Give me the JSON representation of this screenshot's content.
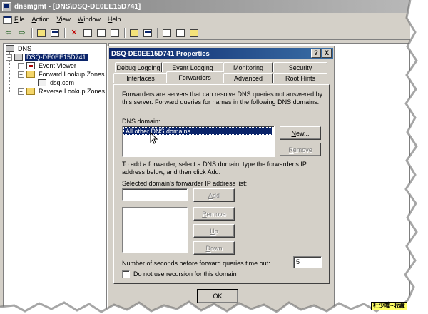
{
  "window": {
    "title": "dnsmgmt - [DNS\\DSQ-DE0EE15D741]"
  },
  "menu": {
    "items": [
      "File",
      "Action",
      "View",
      "Window",
      "Help"
    ]
  },
  "toolbar": {
    "icons": [
      "back-icon",
      "forward-icon",
      "up-folder-icon",
      "show-tree-icon",
      "delete-icon",
      "properties-icon",
      "refresh-icon",
      "export-icon",
      "help-icon",
      "action-icon",
      "list-icon",
      "details-icon",
      "new-zone-icon"
    ]
  },
  "tree": {
    "root": "DNS",
    "server": "DSQ-DE0EE15D741",
    "event_viewer": "Event Viewer",
    "forward_zones": "Forward Lookup Zones",
    "zone": "dsq.com",
    "reverse_zones": "Reverse Lookup Zones"
  },
  "dialog": {
    "title": "DSQ-DE0EE15D741 Properties",
    "help_button": "?",
    "close_button": "X",
    "tabs_row1": [
      "Debug Logging",
      "Event Logging",
      "Monitoring",
      "Security"
    ],
    "tabs_row2": [
      "Interfaces",
      "Forwarders",
      "Advanced",
      "Root Hints"
    ],
    "active_tab": "Forwarders",
    "description": "Forwarders are servers that can resolve DNS queries not answered by this server. Forward queries for names in the following DNS domains.",
    "dns_domain_label": "DNS domain:",
    "domains": [
      "All other DNS domains"
    ],
    "new_button": "New...",
    "remove_button_top": "Remove",
    "add_instruction": "To add a forwarder, select a DNS domain, type the forwarder's IP address below, and then click Add.",
    "ip_list_label": "Selected domain's forwarder IP address list:",
    "ip_placeholder": ".   .   .",
    "add_button": "Add",
    "remove_button": "Remove",
    "up_button": "Up",
    "down_button": "Down",
    "timeout_label": "Number of seconds before forward queries time out:",
    "timeout_value": "5",
    "no_recursion_label": "Do not use recursion for this domain",
    "no_recursion_checked": false,
    "ok_button": "OK"
  },
  "watermark": "社少嘩~收藏"
}
